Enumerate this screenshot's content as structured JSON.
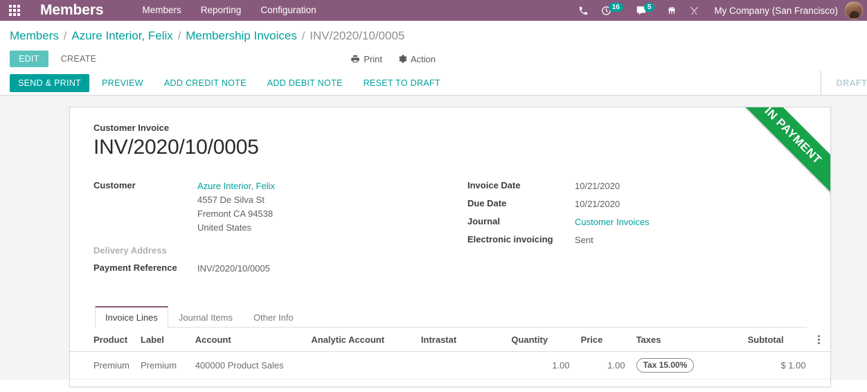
{
  "navbar": {
    "apps_icon": "apps-grid-icon",
    "brand": "Members",
    "menus": [
      {
        "label": "Members"
      },
      {
        "label": "Reporting"
      },
      {
        "label": "Configuration"
      }
    ],
    "icons": [
      {
        "name": "phone-icon"
      },
      {
        "name": "activity-clock-icon",
        "badge": "16"
      },
      {
        "name": "messages-icon",
        "badge": "5"
      },
      {
        "name": "gift-icon"
      },
      {
        "name": "tools-icon"
      }
    ],
    "company": "My Company (San Francisco)",
    "avatar": "user-avatar"
  },
  "breadcrumb": {
    "items": [
      {
        "label": "Members",
        "link": true
      },
      {
        "label": "Azure Interior, Felix",
        "link": true
      },
      {
        "label": "Membership Invoices",
        "link": true
      },
      {
        "label": "INV/2020/10/0005",
        "link": false
      }
    ],
    "separator": "/"
  },
  "control_panel": {
    "edit_label": "EDIT",
    "create_label": "CREATE",
    "print_label": "Print",
    "print_icon": "printer-icon",
    "action_label": "Action",
    "action_icon": "gear-icon"
  },
  "statusbar": {
    "buttons": [
      {
        "label": "SEND & PRINT",
        "primary": true
      },
      {
        "label": "PREVIEW",
        "primary": false
      },
      {
        "label": "ADD CREDIT NOTE",
        "primary": false
      },
      {
        "label": "ADD DEBIT NOTE",
        "primary": false
      },
      {
        "label": "RESET TO DRAFT",
        "primary": false
      }
    ],
    "stage": "DRAFT"
  },
  "sheet": {
    "ribbon": "IN PAYMENT",
    "doc_type": "Customer Invoice",
    "doc_number": "INV/2020/10/0005",
    "left_fields": {
      "customer_label": "Customer",
      "customer_name": "Azure Interior, Felix",
      "customer_address": [
        "4557 De Silva St",
        "Fremont CA 94538",
        "United States"
      ],
      "delivery_address_label": "Delivery Address",
      "delivery_address_value": "",
      "payment_reference_label": "Payment Reference",
      "payment_reference_value": "INV/2020/10/0005"
    },
    "right_fields": [
      {
        "label": "Invoice Date",
        "value": "10/21/2020",
        "link": false
      },
      {
        "label": "Due Date",
        "value": "10/21/2020",
        "link": false
      },
      {
        "label": "Journal",
        "value": "Customer Invoices",
        "link": true
      },
      {
        "label": "Electronic invoicing",
        "value": "Sent",
        "link": false
      }
    ],
    "tabs": [
      {
        "label": "Invoice Lines",
        "active": true
      },
      {
        "label": "Journal Items",
        "active": false
      },
      {
        "label": "Other Info",
        "active": false
      }
    ],
    "table": {
      "columns": [
        "Product",
        "Label",
        "Account",
        "Analytic Account",
        "Intrastat",
        "Quantity",
        "Price",
        "Taxes",
        "Subtotal"
      ],
      "options_icon": "column-options-icon",
      "rows": [
        {
          "product": "Premium",
          "label": "Premium",
          "account": "400000 Product Sales",
          "analytic_account": "",
          "intrastat": "",
          "quantity": "1.00",
          "price": "1.00",
          "taxes": "Tax 15.00%",
          "subtotal": "$ 1.00"
        }
      ]
    }
  },
  "colors": {
    "navbar": "#875A7B",
    "primary_teal": "#00A09D",
    "edit_teal": "#5AC4BD",
    "ribbon_green": "#16A34A",
    "page_bg": "#f4f4f4"
  }
}
